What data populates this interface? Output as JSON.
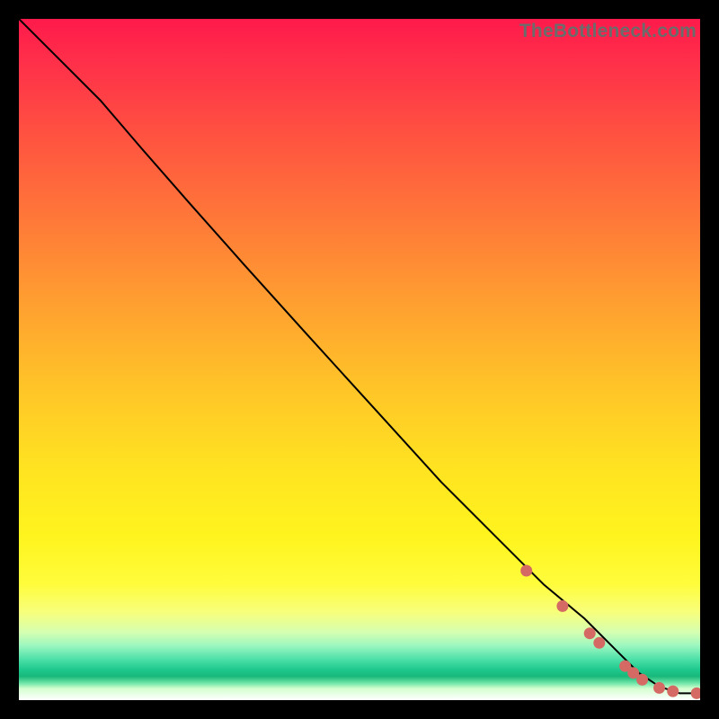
{
  "watermark": "TheBottleneck.com",
  "colors": {
    "dot": "#d46a63",
    "line": "#000000",
    "frame": "#000000"
  },
  "chart_data": {
    "type": "line",
    "title": "",
    "xlabel": "",
    "ylabel": "",
    "xlim": [
      0,
      100
    ],
    "ylim": [
      0,
      100
    ],
    "grid": false,
    "legend": false,
    "series": [
      {
        "name": "curve",
        "x": [
          0,
          3,
          7,
          12,
          18,
          25,
          33,
          42,
          52,
          62,
          70,
          77,
          83,
          88,
          91,
          94,
          97,
          100
        ],
        "y": [
          100,
          97,
          93,
          88,
          81,
          73,
          64,
          54,
          43,
          32,
          24,
          17,
          12,
          7,
          4,
          2,
          1,
          1
        ]
      }
    ],
    "markers": [
      {
        "kind": "segment",
        "x0": 63,
        "y0": 31.5,
        "x1": 68,
        "y1": 26.5
      },
      {
        "kind": "segment",
        "x0": 68.5,
        "y0": 25.5,
        "x1": 71.5,
        "y1": 22.5
      },
      {
        "kind": "segment",
        "x0": 72,
        "y0": 22,
        "x1": 73.5,
        "y1": 20.3
      },
      {
        "kind": "dot",
        "x": 74.5,
        "y": 19.0
      },
      {
        "kind": "segment",
        "x0": 75.5,
        "y0": 18.0,
        "x1": 78.5,
        "y1": 15.0
      },
      {
        "kind": "dot",
        "x": 79.8,
        "y": 13.8
      },
      {
        "kind": "segment",
        "x0": 80.5,
        "y0": 13.0,
        "x1": 82.5,
        "y1": 11.0
      },
      {
        "kind": "dot",
        "x": 83.8,
        "y": 9.8
      },
      {
        "kind": "dot",
        "x": 85.2,
        "y": 8.4
      },
      {
        "kind": "segment",
        "x0": 86.0,
        "y0": 7.6,
        "x1": 87.5,
        "y1": 6.3
      },
      {
        "kind": "dot",
        "x": 89.0,
        "y": 5.0
      },
      {
        "kind": "dot",
        "x": 90.2,
        "y": 4.0
      },
      {
        "kind": "dot",
        "x": 91.5,
        "y": 3.0
      },
      {
        "kind": "dot",
        "x": 94.0,
        "y": 1.8
      },
      {
        "kind": "dot",
        "x": 96.0,
        "y": 1.3
      },
      {
        "kind": "dot",
        "x": 99.5,
        "y": 1.0
      }
    ]
  }
}
